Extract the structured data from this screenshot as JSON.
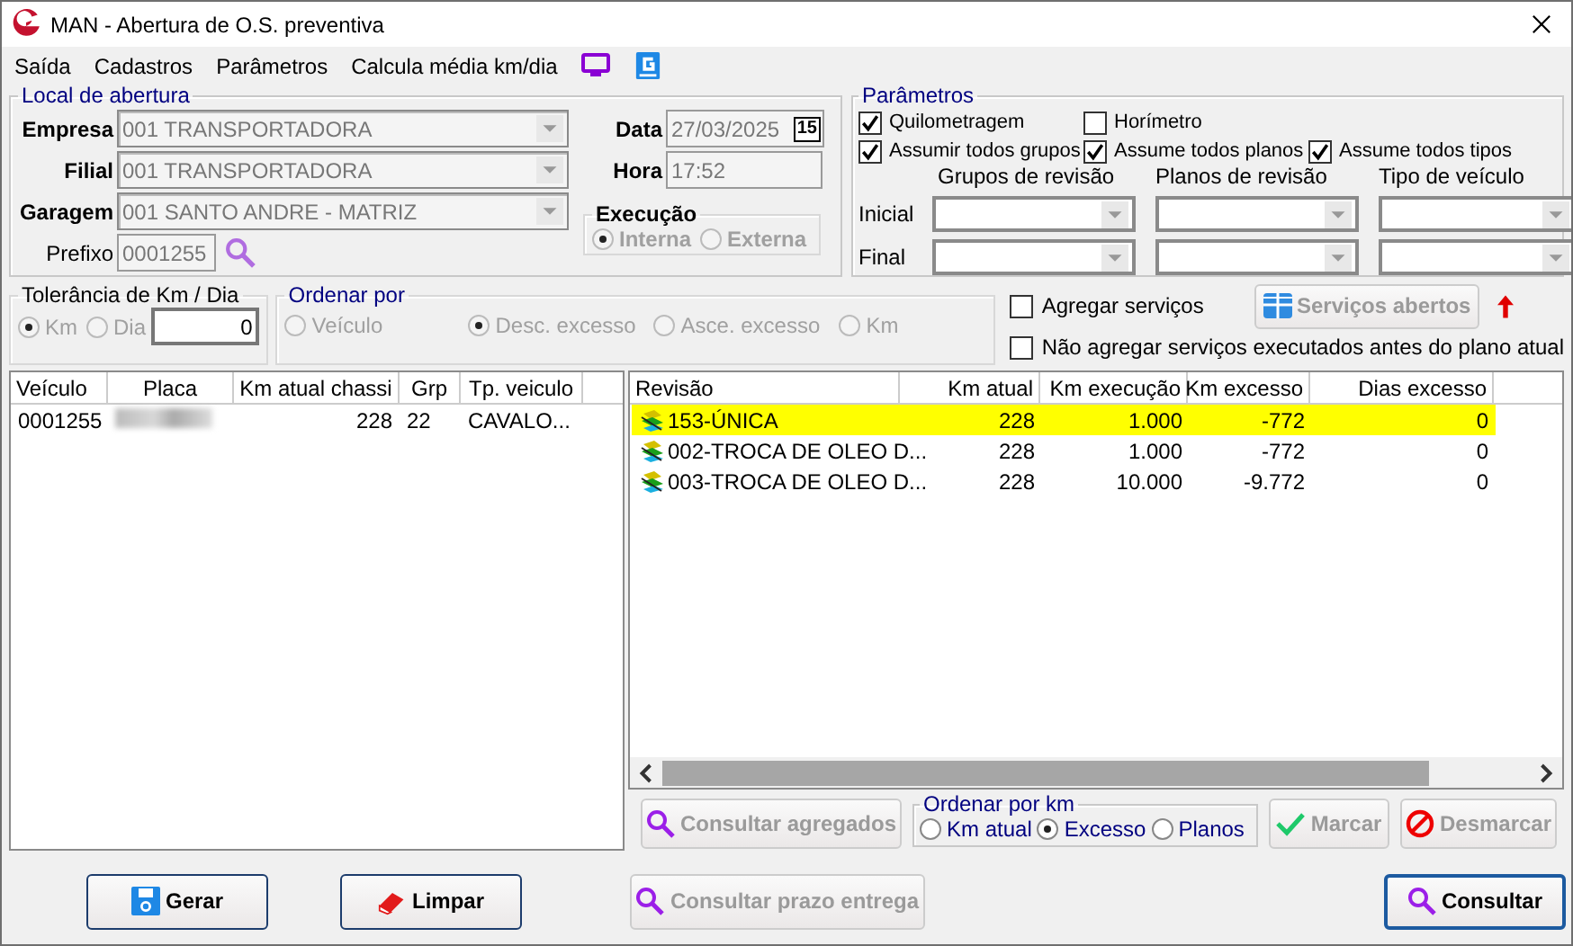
{
  "window": {
    "title": "MAN - Abertura de O.S. preventiva"
  },
  "menu": [
    "Saída",
    "Cadastros",
    "Parâmetros",
    "Calcula média km/dia"
  ],
  "local": {
    "legend": "Local de abertura",
    "fields": [
      {
        "label": "Empresa",
        "value": "001 TRANSPORTADORA",
        "disabled": true
      },
      {
        "label": "Filial",
        "value": "001 TRANSPORTADORA",
        "disabled": true
      },
      {
        "label": "Garagem",
        "value": "001 SANTO ANDRE - MATRIZ",
        "disabled": true
      }
    ],
    "prefixo": {
      "label": "Prefixo",
      "value": "0001255",
      "disabled": true
    },
    "data": {
      "label": "Data",
      "value": "27/03/2025",
      "calendar": "15",
      "disabled": true
    },
    "hora": {
      "label": "Hora",
      "value": "17:52",
      "disabled": true
    },
    "execucao": {
      "legend": "Execução",
      "disabled": true,
      "options": [
        {
          "label": "Interna",
          "selected": true
        },
        {
          "label": "Externa",
          "selected": false
        }
      ]
    }
  },
  "parametros": {
    "legend": "Parâmetros",
    "check_rows": [
      [
        {
          "label": "Quilometragem",
          "checked": true
        },
        {
          "label": "Horímetro",
          "checked": false
        }
      ],
      [
        {
          "label": "Assumir todos grupos",
          "checked": true
        },
        {
          "label": "Assume todos planos",
          "checked": true
        },
        {
          "label": "Assume todos tipos",
          "checked": true
        }
      ]
    ],
    "columns": [
      "Grupos de revisão",
      "Planos de revisão",
      "Tipo de veículo"
    ],
    "rows": [
      "Inicial",
      "Final"
    ]
  },
  "tolerancia": {
    "legend": "Tolerância de Km / Dia",
    "disabled": true,
    "options": [
      {
        "label": "Km",
        "selected": true
      },
      {
        "label": "Dia",
        "selected": false
      }
    ],
    "value": "0"
  },
  "ordenar": {
    "legend": "Ordenar por",
    "disabled": true,
    "options": [
      {
        "label": "Veículo",
        "selected": false
      },
      {
        "label": "Desc. excesso",
        "selected": true
      },
      {
        "label": "Asce. excesso",
        "selected": false
      },
      {
        "label": "Km",
        "selected": false
      }
    ]
  },
  "agregar": {
    "label": "Agregar serviços",
    "checked": false
  },
  "servicos_button": {
    "label": "Serviços abertos",
    "disabled": true
  },
  "nao_agregar": {
    "label": "Não agregar serviços executados antes do plano atual",
    "checked": false
  },
  "vehicles": {
    "columns": [
      "Veículo",
      "Placa",
      "Km atual chassi",
      "Grp",
      "Tp. veiculo"
    ],
    "rows": [
      {
        "selected": false,
        "cells": [
          {
            "kind": "text",
            "text": "0001255"
          },
          {
            "kind": "blurred"
          },
          {
            "kind": "num",
            "text": "228"
          },
          {
            "kind": "text",
            "text": "22"
          },
          {
            "kind": "text",
            "text": "CAVALO..."
          }
        ]
      }
    ]
  },
  "revisions": {
    "columns": [
      "Revisão",
      "Km atual",
      "Km execução",
      "Km excesso",
      "Dias excesso"
    ],
    "rows": [
      {
        "selected": true,
        "cells": [
          "153-ÚNICA",
          "228",
          "1.000",
          "-772",
          "0"
        ]
      },
      {
        "selected": false,
        "cells": [
          "002-TROCA DE OLEO D...",
          "228",
          "1.000",
          "-772",
          "0"
        ]
      },
      {
        "selected": false,
        "cells": [
          "003-TROCA DE OLEO D...",
          "228",
          "10.000",
          "-9.772",
          "0"
        ]
      }
    ]
  },
  "consultar_agregados": {
    "label": "Consultar agregados",
    "disabled": true
  },
  "ordenar_km": {
    "legend": "Ordenar por km",
    "options": [
      {
        "label": "Km atual",
        "selected": false
      },
      {
        "label": "Excesso",
        "selected": true
      },
      {
        "label": "Planos",
        "selected": false
      }
    ]
  },
  "marcar": {
    "label": "Marcar",
    "disabled": true
  },
  "desmarcar": {
    "label": "Desmarcar",
    "disabled": true
  },
  "bottom_buttons": [
    {
      "kind": "gerar",
      "label": "Gerar",
      "disabled": false
    },
    {
      "kind": "limpar",
      "label": "Limpar",
      "disabled": false
    },
    {
      "kind": "prazo",
      "label": "Consultar prazo entrega",
      "disabled": true
    },
    {
      "kind": "consultar",
      "label": "Consultar",
      "disabled": false
    }
  ]
}
